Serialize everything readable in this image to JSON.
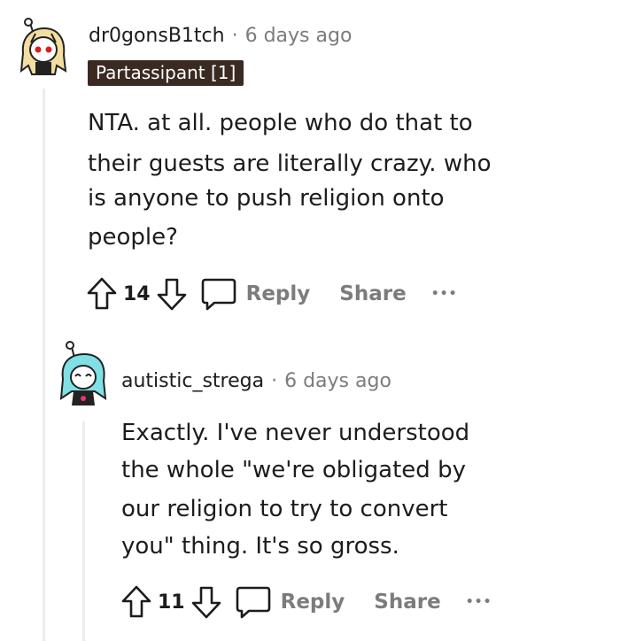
{
  "comments": [
    {
      "username": "dr0gonsB1tch",
      "separator": "·",
      "time": "6 days ago",
      "flair": "Partassipant [1]",
      "body_lines": [
        "NTA. at all. people who do that to",
        "their guests are literally crazy. who",
        "is anyone to push religion onto",
        "people?"
      ],
      "score": "14",
      "reply_label": "Reply",
      "share_label": "Share",
      "more_label": "•••"
    },
    {
      "username": "autistic_strega",
      "separator": "·",
      "time": "6 days ago",
      "body_lines": [
        "Exactly. I've never understood",
        "the whole \"we're obligated by",
        "our religion to try to convert",
        "you\" thing. It's so gross."
      ],
      "score": "11",
      "reply_label": "Reply",
      "share_label": "Share",
      "more_label": "•••"
    }
  ],
  "icons": {
    "upvote": "arrow-up-icon",
    "downvote": "arrow-down-icon",
    "reply": "speech-bubble-icon",
    "more": "more-dots-icon"
  },
  "colors": {
    "text": "#1c1c1c",
    "meta": "#7c7c7c",
    "flair_bg": "#3a2a22",
    "thread_line": "#ececec"
  }
}
